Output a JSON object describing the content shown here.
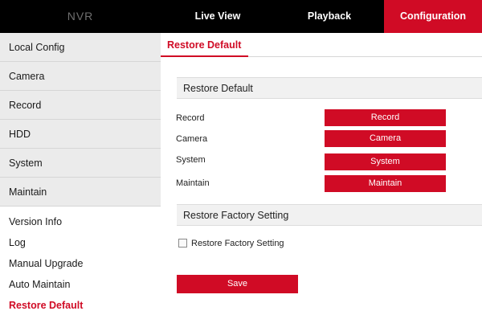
{
  "app": {
    "logo": "NVR"
  },
  "topnav": {
    "live_view": "Live View",
    "playback": "Playback",
    "configuration": "Configuration"
  },
  "sidebar": {
    "items": [
      "Local Config",
      "Camera",
      "Record",
      "HDD",
      "System",
      "Maintain"
    ],
    "subitems": [
      "Version Info",
      "Log",
      "Manual Upgrade",
      "Auto Maintain",
      "Restore Default"
    ],
    "active_subitem": "Restore Default"
  },
  "main": {
    "tab": "Restore Default",
    "section1_title": "Restore Default",
    "rows": [
      {
        "label": "Record",
        "button": "Record"
      },
      {
        "label": "Camera",
        "button": "Camera"
      },
      {
        "label": "System",
        "button": "System"
      },
      {
        "label": "Maintain",
        "button": "Maintain"
      }
    ],
    "section2_title": "Restore Factory Setting",
    "factory_checkbox_label": "Restore Factory Setting",
    "factory_checkbox_checked": false,
    "save_label": "Save"
  },
  "colors": {
    "accent": "#d00b25",
    "topbar": "#000000",
    "sidebar_bg": "#ebebeb"
  }
}
